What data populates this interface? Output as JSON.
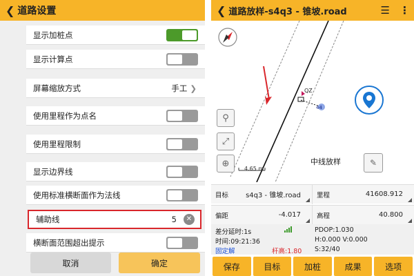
{
  "left": {
    "title": "道路设置",
    "back_icon": "chevron-left-icon",
    "settings": [
      {
        "label": "显示加桩点",
        "type": "toggle",
        "on": true
      },
      {
        "label": "显示计算点",
        "type": "toggle",
        "on": false
      },
      {
        "label": "屏幕缩放方式",
        "type": "value",
        "value": "手工"
      },
      {
        "label": "使用里程作为点名",
        "type": "toggle",
        "on": false
      },
      {
        "label": "使用里程限制",
        "type": "toggle",
        "on": false
      },
      {
        "label": "显示边界线",
        "type": "toggle",
        "on": false
      },
      {
        "label": "使用标准横断面作为法线",
        "type": "toggle",
        "on": false
      },
      {
        "label": "辅助线",
        "type": "input",
        "value": "5"
      },
      {
        "label": "横断面范围超出提示",
        "type": "toggle",
        "on": false
      }
    ],
    "cancel_label": "取消",
    "ok_label": "确定"
  },
  "right": {
    "title": "道路放样-s4q3 - 锥坡.road",
    "map": {
      "point_label": "QZ",
      "point_number": "44",
      "scale": "4.65 m",
      "mode": "中线放样"
    },
    "info": [
      {
        "key": "目标",
        "value": "s4q3 - 锥坡.road"
      },
      {
        "key": "里程",
        "value": "41608.912"
      },
      {
        "key": "偏距",
        "value": "-4.017"
      },
      {
        "key": "高程",
        "value": "40.800"
      }
    ],
    "status": {
      "diff_delay": "差分延时:1s",
      "pdop": "PDOP:1.030",
      "time": "时间:09:21:36",
      "hv": "H:0.000  V:0.000",
      "fix": "固定解",
      "pole": "杆高:1.80",
      "sats": "S:32/40"
    },
    "buttons": [
      "保存",
      "目标",
      "加桩",
      "成果",
      "选项"
    ],
    "colors": {
      "accent": "#f7b428",
      "fix": "#1a4fd6",
      "pole": "#d9262b",
      "location": "#1976d2"
    }
  }
}
